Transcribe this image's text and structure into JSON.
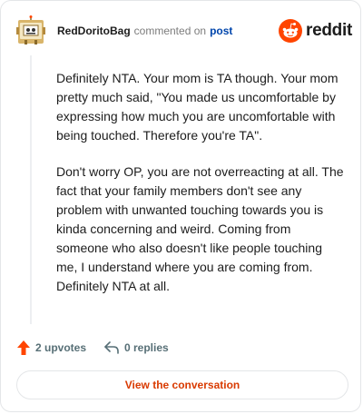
{
  "header": {
    "username": "RedDoritoBag",
    "action_text": "commented on",
    "post_link": "post",
    "brand_word": "reddit"
  },
  "comment": {
    "paragraphs": [
      "Definitely NTA. Your mom is TA though. Your mom pretty much said, \"You made us uncomfortable by expressing how much you are uncomfortable with being touched. Therefore you're TA\".",
      "Don't worry OP, you are not overreacting at all. The fact that your family members don't see any problem with unwanted touching towards you is kinda concerning and weird. Coming from someone who also doesn't like people touching me, I understand where you are coming from. Definitely NTA at all."
    ]
  },
  "actions": {
    "upvotes": "2 upvotes",
    "replies": "0 replies"
  },
  "cta": {
    "label": "View the conversation"
  },
  "colors": {
    "brand_orange": "#ff4500",
    "link_blue": "#0045ac",
    "cta_text": "#d93a00",
    "muted": "#576f76"
  },
  "icons": {
    "avatar": "snoo-avatar",
    "brand": "reddit-snoo-icon",
    "upvote": "upvote-arrow-icon",
    "reply": "reply-arrow-icon"
  }
}
